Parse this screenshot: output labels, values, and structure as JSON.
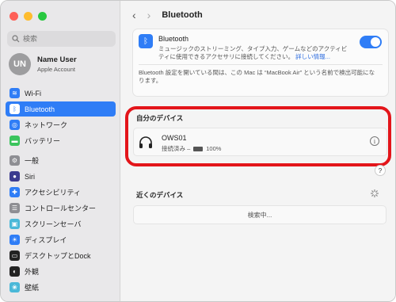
{
  "window": {
    "traffic_colors": [
      "#fe5f57",
      "#febc2e",
      "#28c840"
    ]
  },
  "sidebar": {
    "search_placeholder": "検索",
    "user": {
      "initials": "UN",
      "name": "Name User",
      "subtitle": "Apple Account"
    },
    "group1": [
      {
        "label": "Wi-Fi",
        "icon": "wifi-icon",
        "color": "#2f7df6"
      },
      {
        "label": "Bluetooth",
        "icon": "bluetooth-icon",
        "color": "#2f7df6",
        "active": true
      },
      {
        "label": "ネットワーク",
        "icon": "globe-icon",
        "color": "#2f7df6"
      },
      {
        "label": "バッテリー",
        "icon": "battery-icon",
        "color": "#3ac45c"
      }
    ],
    "group2": [
      {
        "label": "一般",
        "icon": "gear-icon",
        "color": "#8e8e93"
      },
      {
        "label": "Siri",
        "icon": "siri-icon",
        "color": "#3b3b8f"
      },
      {
        "label": "アクセシビリティ",
        "icon": "accessibility-icon",
        "color": "#2f7df6"
      },
      {
        "label": "コントロールセンター",
        "icon": "control-center-icon",
        "color": "#8e8e93"
      },
      {
        "label": "スクリーンセーバ",
        "icon": "screensaver-icon",
        "color": "#4ab8d8"
      },
      {
        "label": "ディスプレイ",
        "icon": "display-icon",
        "color": "#2f7df6"
      },
      {
        "label": "デスクトップとDock",
        "icon": "dock-icon",
        "color": "#222222"
      },
      {
        "label": "外観",
        "icon": "appearance-icon",
        "color": "#222222"
      },
      {
        "label": "壁紙",
        "icon": "wallpaper-icon",
        "color": "#4ab8d8"
      }
    ]
  },
  "main": {
    "title": "Bluetooth",
    "bluetooth_card": {
      "title": "Bluetooth",
      "description": "ミュージックのストリーミング、タイプ入力、ゲームなどのアクティビティに使用できるアクセサリに接続してください。",
      "link": "詳しい情報...",
      "toggle_on": true,
      "note": "Bluetooth 設定を開いている間は、この Mac は “MacBook Air” という名前で検出可能になります。"
    },
    "my_devices_label": "自分のデバイス",
    "device": {
      "name": "OWS01",
      "status_prefix": "接続済み –",
      "battery": "100%"
    },
    "nearby_label": "近くのデバイス",
    "searching_text": "検索中..."
  }
}
